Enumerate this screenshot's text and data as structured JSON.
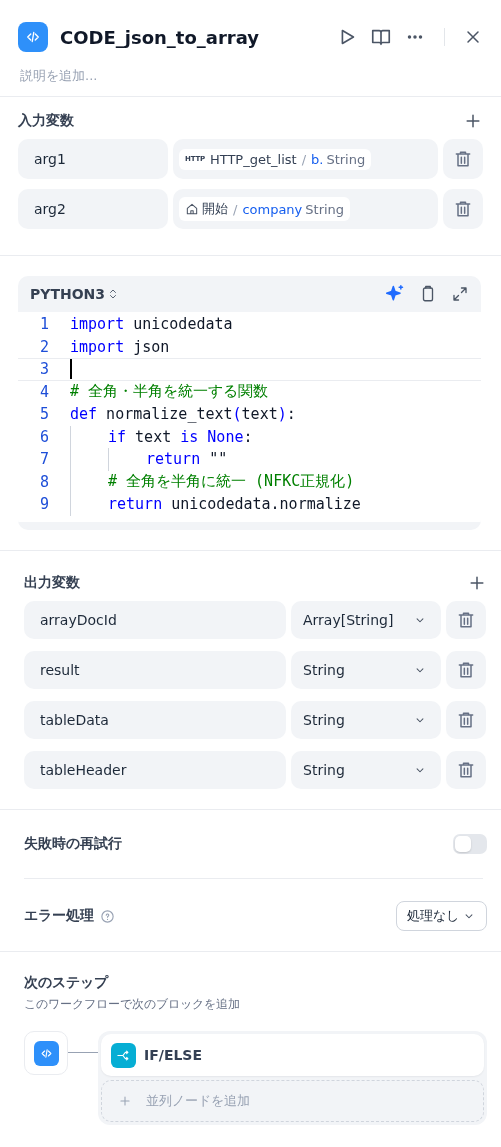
{
  "header": {
    "title": "CODE_json_to_array",
    "description_placeholder": "説明を追加..."
  },
  "inputs": {
    "title": "入力変数",
    "variables": [
      {
        "name": "arg1",
        "kind": "http",
        "badge": "HTTP",
        "source": "HTTP_get_list",
        "separator": "/",
        "field": "b.",
        "type": "String"
      },
      {
        "name": "arg2",
        "kind": "start",
        "source": "開始",
        "separator": "/",
        "field": "company",
        "type": "String"
      }
    ]
  },
  "code": {
    "language": "PYTHON3",
    "lines": [
      {
        "number": "1",
        "tokens": [
          {
            "kind": "keyword",
            "text": "import"
          },
          {
            "kind": "plain",
            "text": " unicodedata"
          }
        ]
      },
      {
        "number": "2",
        "tokens": [
          {
            "kind": "keyword",
            "text": "import"
          },
          {
            "kind": "plain",
            "text": " json"
          }
        ]
      },
      {
        "number": "3",
        "cursor": true
      },
      {
        "number": "4",
        "tokens": [
          {
            "kind": "comment",
            "text": "# 全角・半角を統一する関数"
          }
        ]
      },
      {
        "number": "5",
        "tokens": [
          {
            "kind": "keyword",
            "text": "def"
          },
          {
            "kind": "plain",
            "text": " normalize_text"
          },
          {
            "kind": "keyword",
            "text": "("
          },
          {
            "kind": "plain",
            "text": "text"
          },
          {
            "kind": "keyword",
            "text": ")"
          },
          {
            "kind": "plain",
            "text": ":"
          }
        ],
        "children": [
          {
            "number": "6",
            "tokens": [
              {
                "kind": "keyword",
                "text": "if"
              },
              {
                "kind": "plain",
                "text": " text "
              },
              {
                "kind": "keyword",
                "text": "is"
              },
              {
                "kind": "keyword",
                "text": " None"
              },
              {
                "kind": "plain",
                "text": ":"
              }
            ],
            "children": [
              {
                "number": "7",
                "tokens": [
                  {
                    "kind": "keyword",
                    "text": "return"
                  },
                  {
                    "kind": "plain",
                    "text": " \"\""
                  }
                ]
              }
            ]
          },
          {
            "number": "8",
            "tokens": [
              {
                "kind": "comment",
                "text": "# 全角を半角に統一 (NFKC正規化)"
              }
            ]
          },
          {
            "number": "9",
            "tokens": [
              {
                "kind": "keyword",
                "text": "return"
              },
              {
                "kind": "plain",
                "text": " unicodedata.normalize"
              }
            ]
          }
        ]
      }
    ]
  },
  "outputs": {
    "title": "出力変数",
    "variables": [
      {
        "name": "arrayDocId",
        "type": "Array[String]"
      },
      {
        "name": "result",
        "type": "String"
      },
      {
        "name": "tableData",
        "type": "String"
      },
      {
        "name": "tableHeader",
        "type": "String"
      }
    ]
  },
  "retry": {
    "label": "失敗時の再試行",
    "on": false
  },
  "error_handling": {
    "label": "エラー処理",
    "value": "処理なし"
  },
  "next_step": {
    "title": "次のステップ",
    "subtitle": "このワークフローで次のブロックを追加",
    "nodes": [
      {
        "kind": "ifelse",
        "label": "IF/ELSE"
      }
    ],
    "add_label": "並列ノードを追加"
  }
}
